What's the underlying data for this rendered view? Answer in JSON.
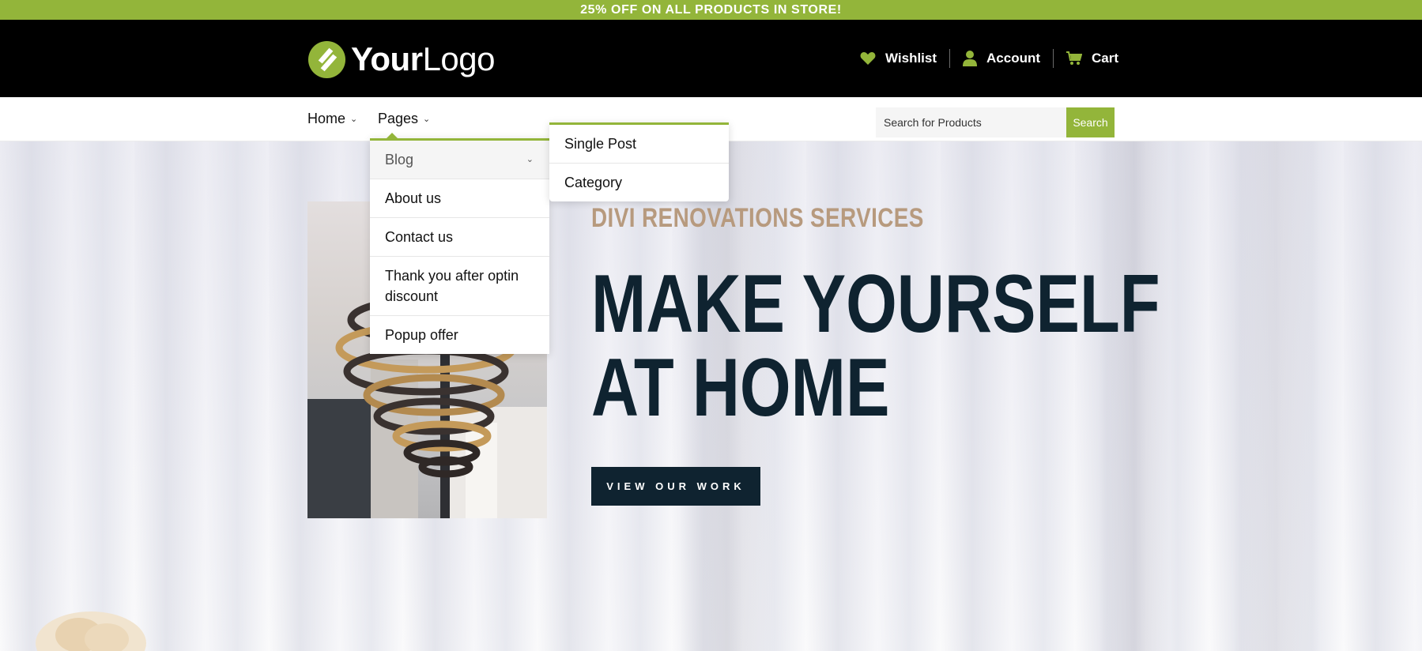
{
  "announcement": {
    "text": "25% OFF ON ALL PRODUCTS IN STORE!"
  },
  "header": {
    "logo": {
      "bold": "Your",
      "light": "Logo"
    },
    "links": [
      {
        "label": "Wishlist",
        "icon": "heart-icon"
      },
      {
        "label": "Account",
        "icon": "user-icon"
      },
      {
        "label": "Cart",
        "icon": "cart-icon"
      }
    ]
  },
  "nav": {
    "items": [
      {
        "label": "Home"
      },
      {
        "label": "Pages"
      }
    ],
    "search": {
      "placeholder": "Search for Products",
      "button_label": "Search"
    }
  },
  "pages_menu": {
    "items": [
      {
        "label": "Blog"
      },
      {
        "label": "About us"
      },
      {
        "label": "Contact us"
      },
      {
        "label": "Thank you after optin discount"
      },
      {
        "label": "Popup offer"
      }
    ]
  },
  "blog_submenu": {
    "items": [
      {
        "label": "Single Post"
      },
      {
        "label": "Category"
      }
    ]
  },
  "hero": {
    "subtitle": "DIVI RENOVATIONS SERVICES",
    "title_line1": "MAKE YOURSELF",
    "title_line2": "AT HOME",
    "cta_label": "VIEW OUR WORK"
  },
  "colors": {
    "accent": "#93b53a",
    "dark": "#0f2330",
    "tan": "#b79a7e"
  }
}
